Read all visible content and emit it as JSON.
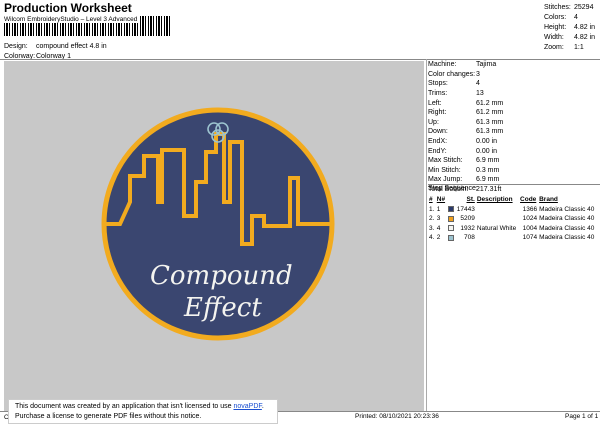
{
  "header": {
    "title": "Production Worksheet",
    "subtitle": "Wilcom EmbroideryStudio – Level 3 Advanced",
    "design_label": "Design:",
    "design_value": "compound effect 4.8 in",
    "colorway_label": "Colorway:",
    "colorway_value": "Colorway 1"
  },
  "stats": [
    {
      "k": "Stitches:",
      "v": "25294"
    },
    {
      "k": "Colors:",
      "v": "4"
    },
    {
      "k": "Height:",
      "v": "4.82 in"
    },
    {
      "k": "Width:",
      "v": "4.82 in"
    },
    {
      "k": "Zoom:",
      "v": "1:1"
    }
  ],
  "machine": [
    {
      "k": "Machine:",
      "v": "Tajima"
    },
    {
      "k": "Color changes:",
      "v": "3"
    },
    {
      "k": "Stops:",
      "v": "4"
    },
    {
      "k": "Trims:",
      "v": "13"
    },
    {
      "k": "Left:",
      "v": "61.2 mm"
    },
    {
      "k": "Right:",
      "v": "61.2 mm"
    },
    {
      "k": "Up:",
      "v": "61.3 mm"
    },
    {
      "k": "Down:",
      "v": "61.3 mm"
    },
    {
      "k": "EndX:",
      "v": "0.00 in"
    },
    {
      "k": "EndY:",
      "v": "0.00 in"
    },
    {
      "k": "Max Stitch:",
      "v": "6.9 mm"
    },
    {
      "k": "Min Stitch:",
      "v": "0.3 mm"
    },
    {
      "k": "Max Jump:",
      "v": "6.9 mm"
    },
    {
      "k": "Total Bobbin:",
      "v": "217.31ft"
    }
  ],
  "stop_sequence": {
    "label": "Stop Sequence:",
    "columns": [
      "#",
      "N#",
      "",
      "St.",
      "Description",
      "Code",
      "Brand"
    ],
    "rows": [
      {
        "n": "1.",
        "stop": "1",
        "color": "#2b3a6b",
        "st": "17443",
        "desc": "",
        "code": "1366",
        "brand": "Madeira Classic 40"
      },
      {
        "n": "2.",
        "stop": "3",
        "color": "#f0a01e",
        "st": "5209",
        "desc": "",
        "code": "1024",
        "brand": "Madeira Classic 40"
      },
      {
        "n": "3.",
        "stop": "4",
        "color": "#f4f4f0",
        "st": "1932",
        "desc": "Natural White",
        "code": "1004",
        "brand": "Madeira Classic 40"
      },
      {
        "n": "4.",
        "stop": "2",
        "color": "#9cc3cf",
        "st": "708",
        "desc": "",
        "code": "1074",
        "brand": "Madeira Classic 40"
      }
    ]
  },
  "design_text": {
    "line1": "Compound",
    "line2": "Effect"
  },
  "colors": {
    "navy": "#3a4670",
    "gold": "#f2ab1f",
    "light_blue": "#9cc3cf",
    "canvas": "#c8c8c8"
  },
  "footer": {
    "left": "Cr",
    "printed": "Printed: 08/10/2021 20:23:36",
    "page": "Page 1 of 1"
  },
  "novapdf": {
    "line1_a": "This document was created by an application that isn't licensed to use ",
    "link": "novaPDF",
    "line1_b": ".",
    "line2": "Purchase a license to generate PDF files without this notice."
  }
}
